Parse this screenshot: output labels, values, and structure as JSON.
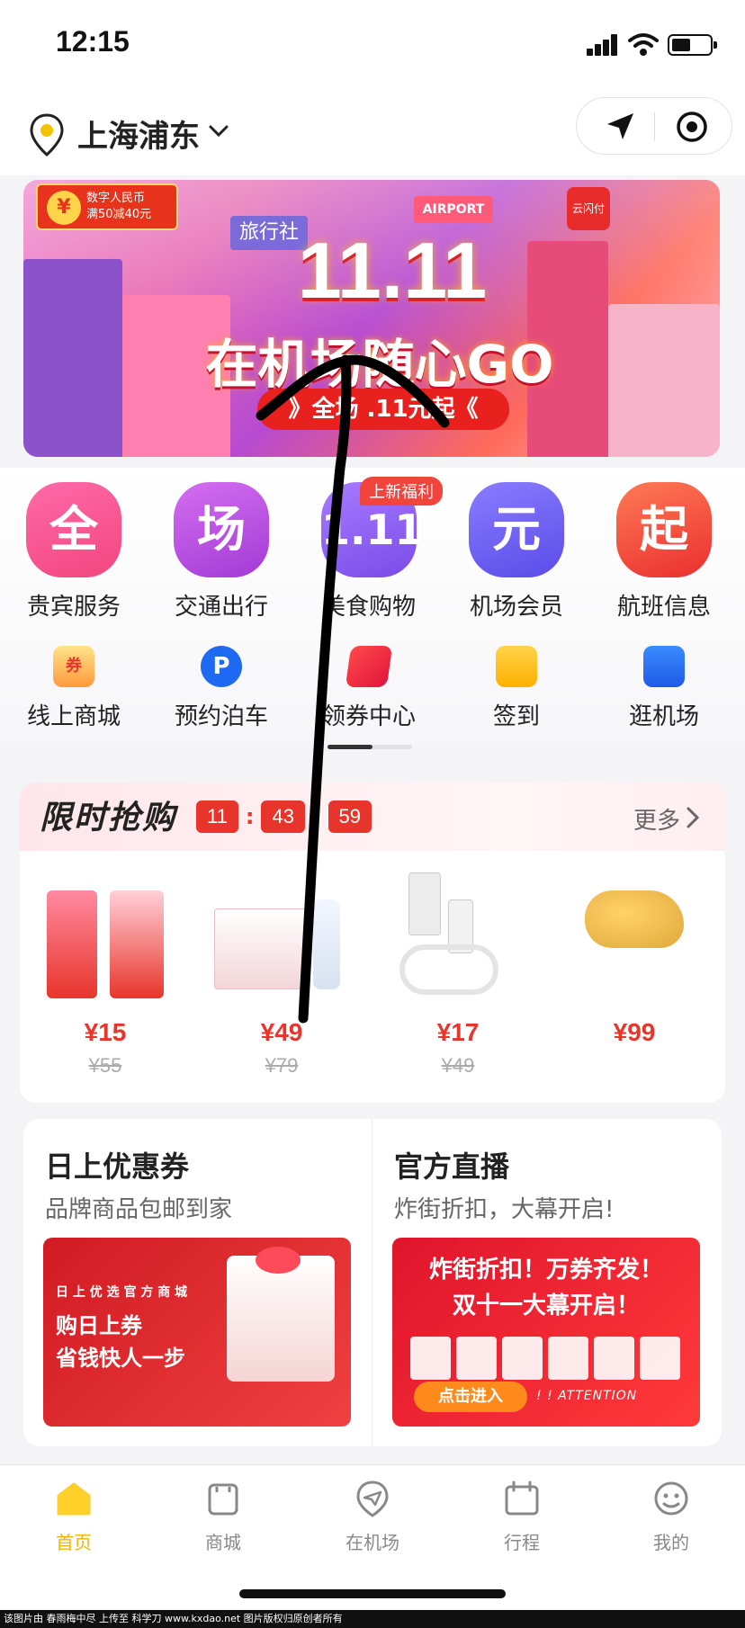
{
  "status_bar": {
    "time": "12:15"
  },
  "header": {
    "city": "上海浦东"
  },
  "banner": {
    "badge_line1": "数字人民币",
    "badge_line2": "满50减40元",
    "coin_symbol": "¥",
    "travel_sign": "旅行社",
    "airport_sign": "AIRPORT",
    "pay_sign": "云闪付",
    "headline": "11.11",
    "slogan": "在机场随心GO",
    "ribbon": "》全场 .11元起《"
  },
  "categories": [
    {
      "label": "贵宾服务",
      "glyph": "全",
      "color": "#f2467e"
    },
    {
      "label": "交通出行",
      "glyph": "场",
      "color": "#b34be0"
    },
    {
      "label": "美食购物",
      "glyph": "1.11",
      "color": "#8e5cf2",
      "tag": "上新福利"
    },
    {
      "label": "机场会员",
      "glyph": "元",
      "color": "#6b5ff2"
    },
    {
      "label": "航班信息",
      "glyph": "起",
      "color": "#f2473a"
    }
  ],
  "sub_items": [
    {
      "label": "线上商城",
      "icon": "coupon-ticket-icon",
      "glyph": "券"
    },
    {
      "label": "预约泊车",
      "icon": "parking-icon",
      "glyph": "P"
    },
    {
      "label": "领券中心",
      "icon": "coupon-center-icon",
      "glyph": ""
    },
    {
      "label": "签到",
      "icon": "checkin-calendar-icon",
      "glyph": ""
    },
    {
      "label": "逛机场",
      "icon": "shopping-bag-plane-icon",
      "glyph": ""
    }
  ],
  "flash_sale": {
    "title": "限时抢购",
    "timer": {
      "hh": "11",
      "mm": "43",
      "ss": "59",
      "sep": ":"
    },
    "more": "更多",
    "products": [
      {
        "price": "¥15",
        "original": "¥55"
      },
      {
        "price": "¥49",
        "original": "¥79"
      },
      {
        "price": "¥17",
        "original": "¥49"
      },
      {
        "price": "¥99",
        "original": ""
      }
    ]
  },
  "cards": {
    "left": {
      "title": "日上优惠券",
      "subtitle": "品牌商品包邮到家",
      "pic_small": "日 上 优 选 官 方 商 城",
      "pic_line1": "购日上券",
      "pic_line2": "省钱快人一步"
    },
    "right": {
      "title": "官方直播",
      "subtitle": "炸街折扣，大幕开启!",
      "pic_line1": "炸街折扣！万券齐发！",
      "pic_line2": "双十一大幕开启！",
      "enter": "点击进入",
      "attention": "! ! ATTENTION"
    }
  },
  "tabbar": [
    {
      "label": "首页",
      "active": true
    },
    {
      "label": "商城",
      "active": false
    },
    {
      "label": "在机场",
      "active": false
    },
    {
      "label": "行程",
      "active": false
    },
    {
      "label": "我的",
      "active": false
    }
  ],
  "footer": "该图片由 春雨梅中尽 上传至 科学刀 www.kxdao.net 图片版权归原创者所有"
}
